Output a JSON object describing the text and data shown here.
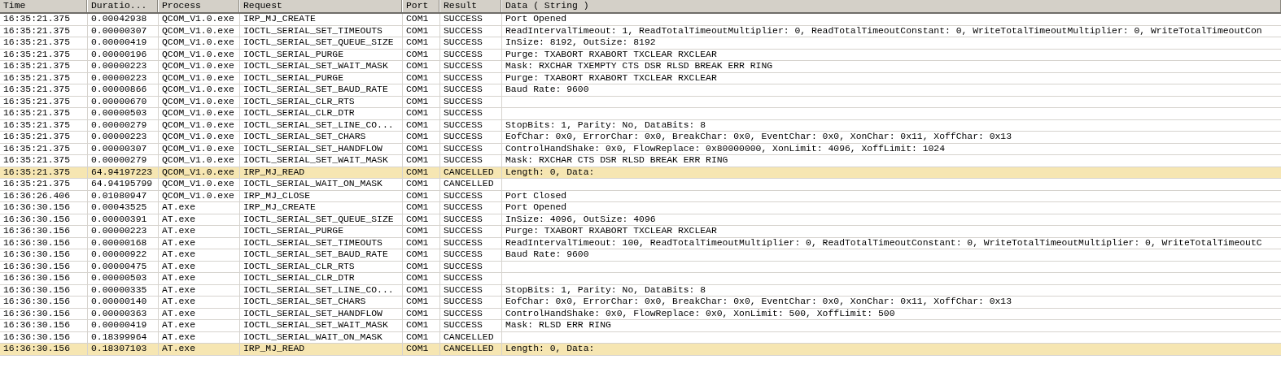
{
  "table": {
    "columns": [
      "Time",
      "Duratio...",
      "Process",
      "Request",
      "Port",
      "Result",
      "Data ( String )"
    ],
    "rows": [
      {
        "time": "16:35:21.375",
        "duration": "0.00042938",
        "process": "QCOM_V1.0.exe",
        "request": "IRP_MJ_CREATE",
        "port": "COM1",
        "result": "SUCCESS",
        "data": "Port Opened",
        "highlighted": false
      },
      {
        "time": "16:35:21.375",
        "duration": "0.00000307",
        "process": "QCOM_V1.0.exe",
        "request": "IOCTL_SERIAL_SET_TIMEOUTS",
        "port": "COM1",
        "result": "SUCCESS",
        "data": "ReadIntervalTimeout: 1, ReadTotalTimeoutMultiplier: 0, ReadTotalTimeoutConstant: 0, WriteTotalTimeoutMultiplier: 0, WriteTotalTimeoutCon",
        "highlighted": false
      },
      {
        "time": "16:35:21.375",
        "duration": "0.00000419",
        "process": "QCOM_V1.0.exe",
        "request": "IOCTL_SERIAL_SET_QUEUE_SIZE",
        "port": "COM1",
        "result": "SUCCESS",
        "data": "InSize: 8192, OutSize: 8192",
        "highlighted": false
      },
      {
        "time": "16:35:21.375",
        "duration": "0.00000196",
        "process": "QCOM_V1.0.exe",
        "request": "IOCTL_SERIAL_PURGE",
        "port": "COM1",
        "result": "SUCCESS",
        "data": "Purge: TXABORT RXABORT TXCLEAR RXCLEAR",
        "highlighted": false
      },
      {
        "time": "16:35:21.375",
        "duration": "0.00000223",
        "process": "QCOM_V1.0.exe",
        "request": "IOCTL_SERIAL_SET_WAIT_MASK",
        "port": "COM1",
        "result": "SUCCESS",
        "data": "Mask: RXCHAR TXEMPTY CTS DSR RLSD BREAK ERR RING",
        "highlighted": false
      },
      {
        "time": "16:35:21.375",
        "duration": "0.00000223",
        "process": "QCOM_V1.0.exe",
        "request": "IOCTL_SERIAL_PURGE",
        "port": "COM1",
        "result": "SUCCESS",
        "data": "Purge: TXABORT RXABORT TXCLEAR RXCLEAR",
        "highlighted": false
      },
      {
        "time": "16:35:21.375",
        "duration": "0.00000866",
        "process": "QCOM_V1.0.exe",
        "request": "IOCTL_SERIAL_SET_BAUD_RATE",
        "port": "COM1",
        "result": "SUCCESS",
        "data": "Baud Rate: 9600",
        "highlighted": false
      },
      {
        "time": "16:35:21.375",
        "duration": "0.00000670",
        "process": "QCOM_V1.0.exe",
        "request": "IOCTL_SERIAL_CLR_RTS",
        "port": "COM1",
        "result": "SUCCESS",
        "highlighted": false
      },
      {
        "time": "16:35:21.375",
        "duration": "0.00000503",
        "process": "QCOM_V1.0.exe",
        "request": "IOCTL_SERIAL_CLR_DTR",
        "port": "COM1",
        "result": "SUCCESS",
        "highlighted": false
      },
      {
        "time": "16:35:21.375",
        "duration": "0.00000279",
        "process": "QCOM_V1.0.exe",
        "request": "IOCTL_SERIAL_SET_LINE_CO...",
        "port": "COM1",
        "result": "SUCCESS",
        "data": "StopBits: 1, Parity: No, DataBits: 8",
        "highlighted": false
      },
      {
        "time": "16:35:21.375",
        "duration": "0.00000223",
        "process": "QCOM_V1.0.exe",
        "request": "IOCTL_SERIAL_SET_CHARS",
        "port": "COM1",
        "result": "SUCCESS",
        "data": "EofChar: 0x0, ErrorChar: 0x0, BreakChar: 0x0, EventChar: 0x0, XonChar: 0x11, XoffChar: 0x13",
        "highlighted": false
      },
      {
        "time": "16:35:21.375",
        "duration": "0.00000307",
        "process": "QCOM_V1.0.exe",
        "request": "IOCTL_SERIAL_SET_HANDFLOW",
        "port": "COM1",
        "result": "SUCCESS",
        "data": "ControlHandShake: 0x0, FlowReplace: 0x80000000, XonLimit: 4096, XoffLimit: 1024",
        "highlighted": false
      },
      {
        "time": "16:35:21.375",
        "duration": "0.00000279",
        "process": "QCOM_V1.0.exe",
        "request": "IOCTL_SERIAL_SET_WAIT_MASK",
        "port": "COM1",
        "result": "SUCCESS",
        "data": "Mask: RXCHAR CTS DSR RLSD BREAK ERR RING",
        "highlighted": false
      },
      {
        "time": "16:35:21.375",
        "duration": "64.94197223",
        "process": "QCOM_V1.0.exe",
        "request": "IRP_MJ_READ",
        "port": "COM1",
        "result": "CANCELLED",
        "data": "Length: 0, Data:",
        "highlighted": true
      },
      {
        "time": "16:35:21.375",
        "duration": "64.94195799",
        "process": "QCOM_V1.0.exe",
        "request": "IOCTL_SERIAL_WAIT_ON_MASK",
        "port": "COM1",
        "result": "CANCELLED",
        "highlighted": false
      },
      {
        "time": "16:36:26.406",
        "duration": "0.01080947",
        "process": "QCOM_V1.0.exe",
        "request": "IRP_MJ_CLOSE",
        "port": "COM1",
        "result": "SUCCESS",
        "data": "Port Closed",
        "highlighted": false
      },
      {
        "time": "16:36:30.156",
        "duration": "0.00043525",
        "process": "AT.exe",
        "request": "IRP_MJ_CREATE",
        "port": "COM1",
        "result": "SUCCESS",
        "data": "Port Opened",
        "highlighted": false
      },
      {
        "time": "16:36:30.156",
        "duration": "0.00000391",
        "process": "AT.exe",
        "request": "IOCTL_SERIAL_SET_QUEUE_SIZE",
        "port": "COM1",
        "result": "SUCCESS",
        "data": "InSize: 4096, OutSize: 4096",
        "highlighted": false
      },
      {
        "time": "16:36:30.156",
        "duration": "0.00000223",
        "process": "AT.exe",
        "request": "IOCTL_SERIAL_PURGE",
        "port": "COM1",
        "result": "SUCCESS",
        "data": "Purge: TXABORT RXABORT TXCLEAR RXCLEAR",
        "highlighted": false
      },
      {
        "time": "16:36:30.156",
        "duration": "0.00000168",
        "process": "AT.exe",
        "request": "IOCTL_SERIAL_SET_TIMEOUTS",
        "port": "COM1",
        "result": "SUCCESS",
        "data": "ReadIntervalTimeout: 100, ReadTotalTimeoutMultiplier: 0, ReadTotalTimeoutConstant: 0, WriteTotalTimeoutMultiplier: 0, WriteTotalTimeoutC",
        "highlighted": false
      },
      {
        "time": "16:36:30.156",
        "duration": "0.00000922",
        "process": "AT.exe",
        "request": "IOCTL_SERIAL_SET_BAUD_RATE",
        "port": "COM1",
        "result": "SUCCESS",
        "data": "Baud Rate: 9600",
        "highlighted": false
      },
      {
        "time": "16:36:30.156",
        "duration": "0.00000475",
        "process": "AT.exe",
        "request": "IOCTL_SERIAL_CLR_RTS",
        "port": "COM1",
        "result": "SUCCESS",
        "highlighted": false
      },
      {
        "time": "16:36:30.156",
        "duration": "0.00000503",
        "process": "AT.exe",
        "request": "IOCTL_SERIAL_CLR_DTR",
        "port": "COM1",
        "result": "SUCCESS",
        "highlighted": false
      },
      {
        "time": "16:36:30.156",
        "duration": "0.00000335",
        "process": "AT.exe",
        "request": "IOCTL_SERIAL_SET_LINE_CO...",
        "port": "COM1",
        "result": "SUCCESS",
        "data": "StopBits: 1, Parity: No, DataBits: 8",
        "highlighted": false
      },
      {
        "time": "16:36:30.156",
        "duration": "0.00000140",
        "process": "AT.exe",
        "request": "IOCTL_SERIAL_SET_CHARS",
        "port": "COM1",
        "result": "SUCCESS",
        "data": "EofChar: 0x0, ErrorChar: 0x0, BreakChar: 0x0, EventChar: 0x0, XonChar: 0x11, XoffChar: 0x13",
        "highlighted": false
      },
      {
        "time": "16:36:30.156",
        "duration": "0.00000363",
        "process": "AT.exe",
        "request": "IOCTL_SERIAL_SET_HANDFLOW",
        "port": "COM1",
        "result": "SUCCESS",
        "data": "ControlHandShake: 0x0, FlowReplace: 0x0, XonLimit: 500, XoffLimit: 500",
        "highlighted": false
      },
      {
        "time": "16:36:30.156",
        "duration": "0.00000419",
        "process": "AT.exe",
        "request": "IOCTL_SERIAL_SET_WAIT_MASK",
        "port": "COM1",
        "result": "SUCCESS",
        "data": "Mask: RLSD ERR RING",
        "highlighted": false
      },
      {
        "time": "16:36:30.156",
        "duration": "0.18399964",
        "process": "AT.exe",
        "request": "IOCTL_SERIAL_WAIT_ON_MASK",
        "port": "COM1",
        "result": "CANCELLED",
        "highlighted": false
      },
      {
        "time": "16:36:30.156",
        "duration": "0.18307103",
        "process": "AT.exe",
        "request": "IRP_MJ_READ",
        "port": "COM1",
        "result": "CANCELLED",
        "data": "Length: 0, Data:",
        "highlighted": true
      }
    ]
  }
}
